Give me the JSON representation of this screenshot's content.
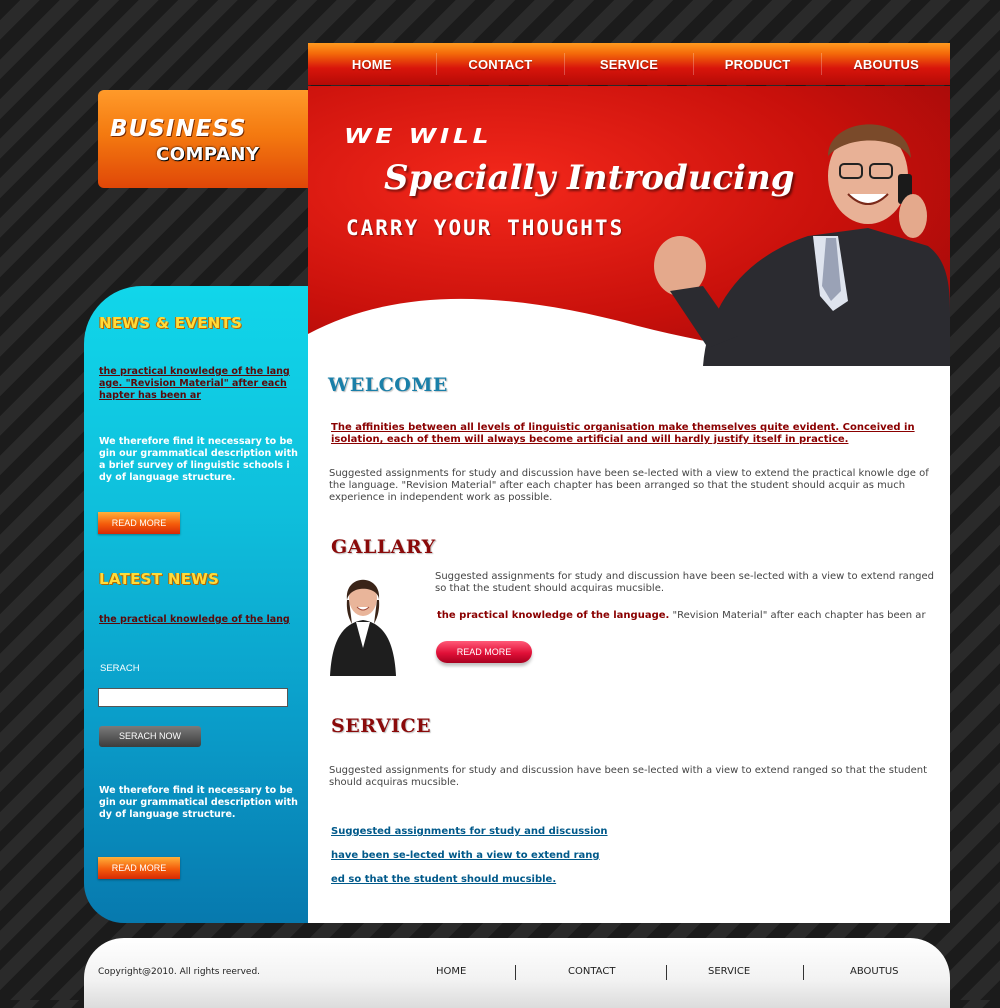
{
  "nav": {
    "items": [
      {
        "label": "HOME"
      },
      {
        "label": "CONTACT"
      },
      {
        "label": "SERVICE"
      },
      {
        "label": "PRODUCT"
      },
      {
        "label": "ABOUTUS"
      }
    ]
  },
  "logo": {
    "line1": "BUSINESS",
    "line2": "COMPANY"
  },
  "hero": {
    "line1": "WE WILL",
    "line2": "Specially Introducing",
    "line3": "CARRY YOUR THOUGHTS"
  },
  "sidebar": {
    "news_heading": "NEWS & EVENTS",
    "news_link": "the practical knowledge of the lang age. \"Revision Material\" after each hapter has been ar",
    "news_text": "We therefore find it necessary to be gin our grammatical description with a brief survey of linguistic schools i dy of language structure.",
    "read_more_1": "READ MORE",
    "latest_heading": "LATEST NEWS",
    "latest_link": "the practical knowledge of the lang",
    "search_label": "SERACH",
    "search_value": "",
    "search_button": "SERACH NOW",
    "bottom_text": "We therefore find it necessary to be gin our grammatical description with dy of language structure.",
    "read_more_2": "READ MORE"
  },
  "welcome": {
    "title": "WELCOME",
    "red_link": "The affinities between all levels of linguistic organisation make themselves quite evident. Conceived in isolation, each of them will always become artificial and will hardly justify itself in practice.",
    "text": "Suggested assignments for study and discussion have been se-lected with a view to extend the practical knowle dge of the language. \"Revision Material\" after each chapter has been arranged so that the student should acquir as much experience in independent work as possible."
  },
  "gallery": {
    "title": "GALLARY",
    "text": "Suggested assignments for study and discussion have been se-lected with a view to extend ranged so that the student should acquiras mucsible.",
    "bold_part": "the practical knowledge of the language.",
    "normal_part": " \"Revision Material\" after each chapter has been ar",
    "button": "READ MORE"
  },
  "service": {
    "title": "SERVICE",
    "text": "Suggested assignments for study and discussion have been se-lected with a view to extend ranged so that the student should acquiras mucsible.",
    "links": [
      "Suggested assignments for study and discussion ",
      "have been se-lected with a view to extend rang",
      "ed so that the student should mucsible."
    ]
  },
  "footer": {
    "copyright": "Copyright@2010. All rights reerved.",
    "links": [
      "HOME",
      "CONTACT",
      "SERVICE",
      "ABOUTUS"
    ]
  },
  "colors": {
    "nav_red": "#d8150b",
    "accent_orange": "#f47a10",
    "sidebar_cyan": "#11d6ea",
    "welcome_blue": "#1a7fa8",
    "title_red": "#8a0a0a",
    "link_blue": "#00598a"
  }
}
